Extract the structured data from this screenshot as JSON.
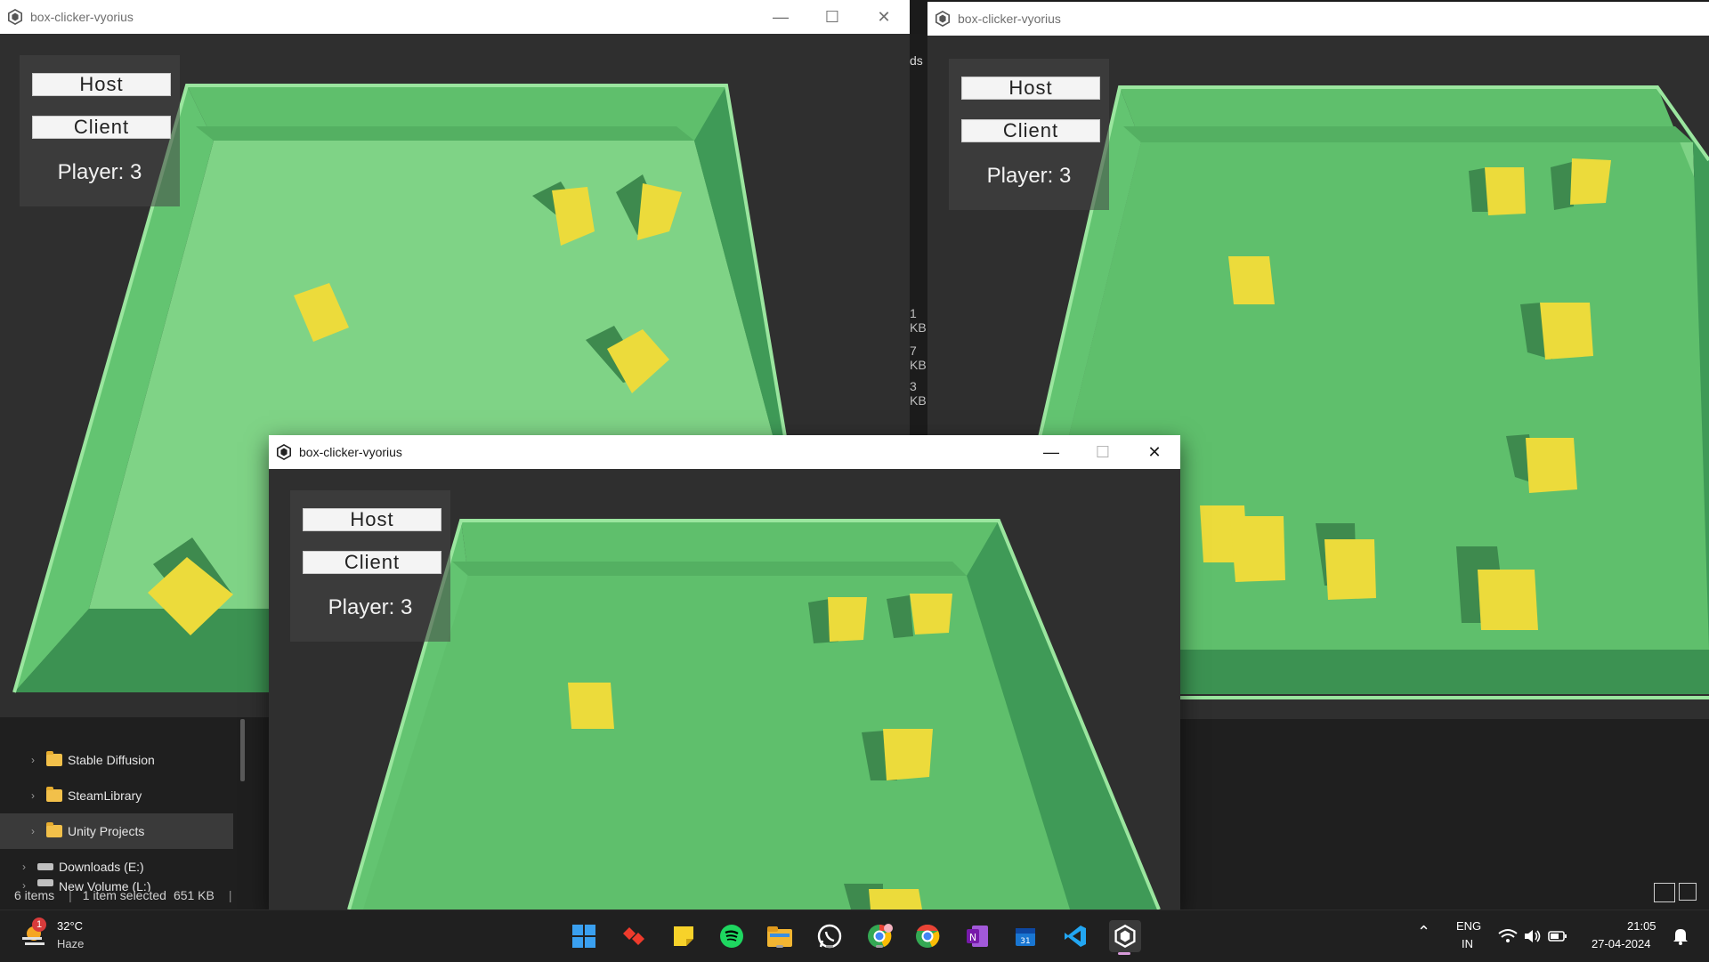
{
  "windows": [
    {
      "title": "box-clicker-vyorius",
      "host": "Host",
      "client": "Client",
      "player": "Player: 3"
    },
    {
      "title": "box-clicker-vyorius",
      "host": "Host",
      "client": "Client",
      "player": "Player: 3"
    },
    {
      "title": "box-clicker-vyorius",
      "host": "Host",
      "client": "Client",
      "player": "Player: 3"
    }
  ],
  "window_controls": {
    "minimize": "—",
    "maximize": "☐",
    "close": "✕"
  },
  "explorer": {
    "tree": [
      {
        "label": "Stable Diffusion",
        "icon": "folder-icon"
      },
      {
        "label": "SteamLibrary",
        "icon": "folder-icon"
      },
      {
        "label": "Unity Projects",
        "icon": "folder-icon"
      },
      {
        "label": "Downloads (E:)",
        "icon": "drive-icon"
      },
      {
        "label": "New Volume (L:)",
        "icon": "drive-icon"
      }
    ],
    "status": {
      "items": "6 items",
      "selected": "1 item selected",
      "size": "651 KB"
    },
    "peek": {
      "fragment1": "ds",
      "kb1": "1 KB",
      "kb2": "7 KB",
      "kb3": "3 KB"
    }
  },
  "taskbar": {
    "weather": {
      "temp": "32°C",
      "condition": "Haze",
      "badge": "1"
    },
    "apps": [
      "windows-start-icon",
      "anydesk-icon",
      "sticky-notes-icon",
      "spotify-icon",
      "file-explorer-icon",
      "whatsapp-icon",
      "chrome-profile-icon",
      "chrome-icon",
      "onenote-icon",
      "calendar-icon",
      "vscode-icon",
      "unity-icon"
    ],
    "tray": {
      "lang": "ENG",
      "region": "IN",
      "time": "21:05",
      "date": "27-04-2024"
    }
  },
  "colors": {
    "floor": "#7fd386",
    "wall_top": "#6fd079",
    "wall_side": "#3e9a55",
    "box": "#eddd3a",
    "box_shadow": "#3a7a45"
  }
}
